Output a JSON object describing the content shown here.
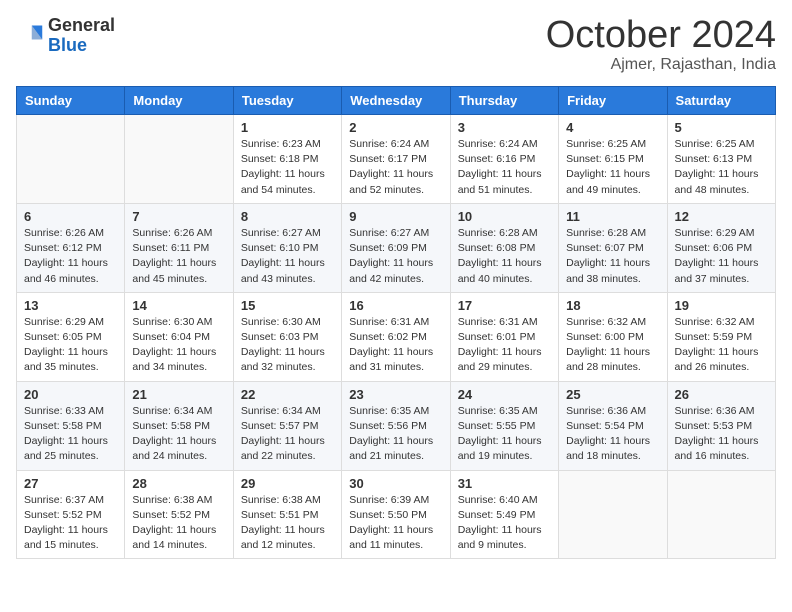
{
  "logo": {
    "general": "General",
    "blue": "Blue"
  },
  "title": "October 2024",
  "location": "Ajmer, Rajasthan, India",
  "headers": [
    "Sunday",
    "Monday",
    "Tuesday",
    "Wednesday",
    "Thursday",
    "Friday",
    "Saturday"
  ],
  "weeks": [
    [
      {
        "day": "",
        "info": ""
      },
      {
        "day": "",
        "info": ""
      },
      {
        "day": "1",
        "info": "Sunrise: 6:23 AM\nSunset: 6:18 PM\nDaylight: 11 hours and 54 minutes."
      },
      {
        "day": "2",
        "info": "Sunrise: 6:24 AM\nSunset: 6:17 PM\nDaylight: 11 hours and 52 minutes."
      },
      {
        "day": "3",
        "info": "Sunrise: 6:24 AM\nSunset: 6:16 PM\nDaylight: 11 hours and 51 minutes."
      },
      {
        "day": "4",
        "info": "Sunrise: 6:25 AM\nSunset: 6:15 PM\nDaylight: 11 hours and 49 minutes."
      },
      {
        "day": "5",
        "info": "Sunrise: 6:25 AM\nSunset: 6:13 PM\nDaylight: 11 hours and 48 minutes."
      }
    ],
    [
      {
        "day": "6",
        "info": "Sunrise: 6:26 AM\nSunset: 6:12 PM\nDaylight: 11 hours and 46 minutes."
      },
      {
        "day": "7",
        "info": "Sunrise: 6:26 AM\nSunset: 6:11 PM\nDaylight: 11 hours and 45 minutes."
      },
      {
        "day": "8",
        "info": "Sunrise: 6:27 AM\nSunset: 6:10 PM\nDaylight: 11 hours and 43 minutes."
      },
      {
        "day": "9",
        "info": "Sunrise: 6:27 AM\nSunset: 6:09 PM\nDaylight: 11 hours and 42 minutes."
      },
      {
        "day": "10",
        "info": "Sunrise: 6:28 AM\nSunset: 6:08 PM\nDaylight: 11 hours and 40 minutes."
      },
      {
        "day": "11",
        "info": "Sunrise: 6:28 AM\nSunset: 6:07 PM\nDaylight: 11 hours and 38 minutes."
      },
      {
        "day": "12",
        "info": "Sunrise: 6:29 AM\nSunset: 6:06 PM\nDaylight: 11 hours and 37 minutes."
      }
    ],
    [
      {
        "day": "13",
        "info": "Sunrise: 6:29 AM\nSunset: 6:05 PM\nDaylight: 11 hours and 35 minutes."
      },
      {
        "day": "14",
        "info": "Sunrise: 6:30 AM\nSunset: 6:04 PM\nDaylight: 11 hours and 34 minutes."
      },
      {
        "day": "15",
        "info": "Sunrise: 6:30 AM\nSunset: 6:03 PM\nDaylight: 11 hours and 32 minutes."
      },
      {
        "day": "16",
        "info": "Sunrise: 6:31 AM\nSunset: 6:02 PM\nDaylight: 11 hours and 31 minutes."
      },
      {
        "day": "17",
        "info": "Sunrise: 6:31 AM\nSunset: 6:01 PM\nDaylight: 11 hours and 29 minutes."
      },
      {
        "day": "18",
        "info": "Sunrise: 6:32 AM\nSunset: 6:00 PM\nDaylight: 11 hours and 28 minutes."
      },
      {
        "day": "19",
        "info": "Sunrise: 6:32 AM\nSunset: 5:59 PM\nDaylight: 11 hours and 26 minutes."
      }
    ],
    [
      {
        "day": "20",
        "info": "Sunrise: 6:33 AM\nSunset: 5:58 PM\nDaylight: 11 hours and 25 minutes."
      },
      {
        "day": "21",
        "info": "Sunrise: 6:34 AM\nSunset: 5:58 PM\nDaylight: 11 hours and 24 minutes."
      },
      {
        "day": "22",
        "info": "Sunrise: 6:34 AM\nSunset: 5:57 PM\nDaylight: 11 hours and 22 minutes."
      },
      {
        "day": "23",
        "info": "Sunrise: 6:35 AM\nSunset: 5:56 PM\nDaylight: 11 hours and 21 minutes."
      },
      {
        "day": "24",
        "info": "Sunrise: 6:35 AM\nSunset: 5:55 PM\nDaylight: 11 hours and 19 minutes."
      },
      {
        "day": "25",
        "info": "Sunrise: 6:36 AM\nSunset: 5:54 PM\nDaylight: 11 hours and 18 minutes."
      },
      {
        "day": "26",
        "info": "Sunrise: 6:36 AM\nSunset: 5:53 PM\nDaylight: 11 hours and 16 minutes."
      }
    ],
    [
      {
        "day": "27",
        "info": "Sunrise: 6:37 AM\nSunset: 5:52 PM\nDaylight: 11 hours and 15 minutes."
      },
      {
        "day": "28",
        "info": "Sunrise: 6:38 AM\nSunset: 5:52 PM\nDaylight: 11 hours and 14 minutes."
      },
      {
        "day": "29",
        "info": "Sunrise: 6:38 AM\nSunset: 5:51 PM\nDaylight: 11 hours and 12 minutes."
      },
      {
        "day": "30",
        "info": "Sunrise: 6:39 AM\nSunset: 5:50 PM\nDaylight: 11 hours and 11 minutes."
      },
      {
        "day": "31",
        "info": "Sunrise: 6:40 AM\nSunset: 5:49 PM\nDaylight: 11 hours and 9 minutes."
      },
      {
        "day": "",
        "info": ""
      },
      {
        "day": "",
        "info": ""
      }
    ]
  ]
}
